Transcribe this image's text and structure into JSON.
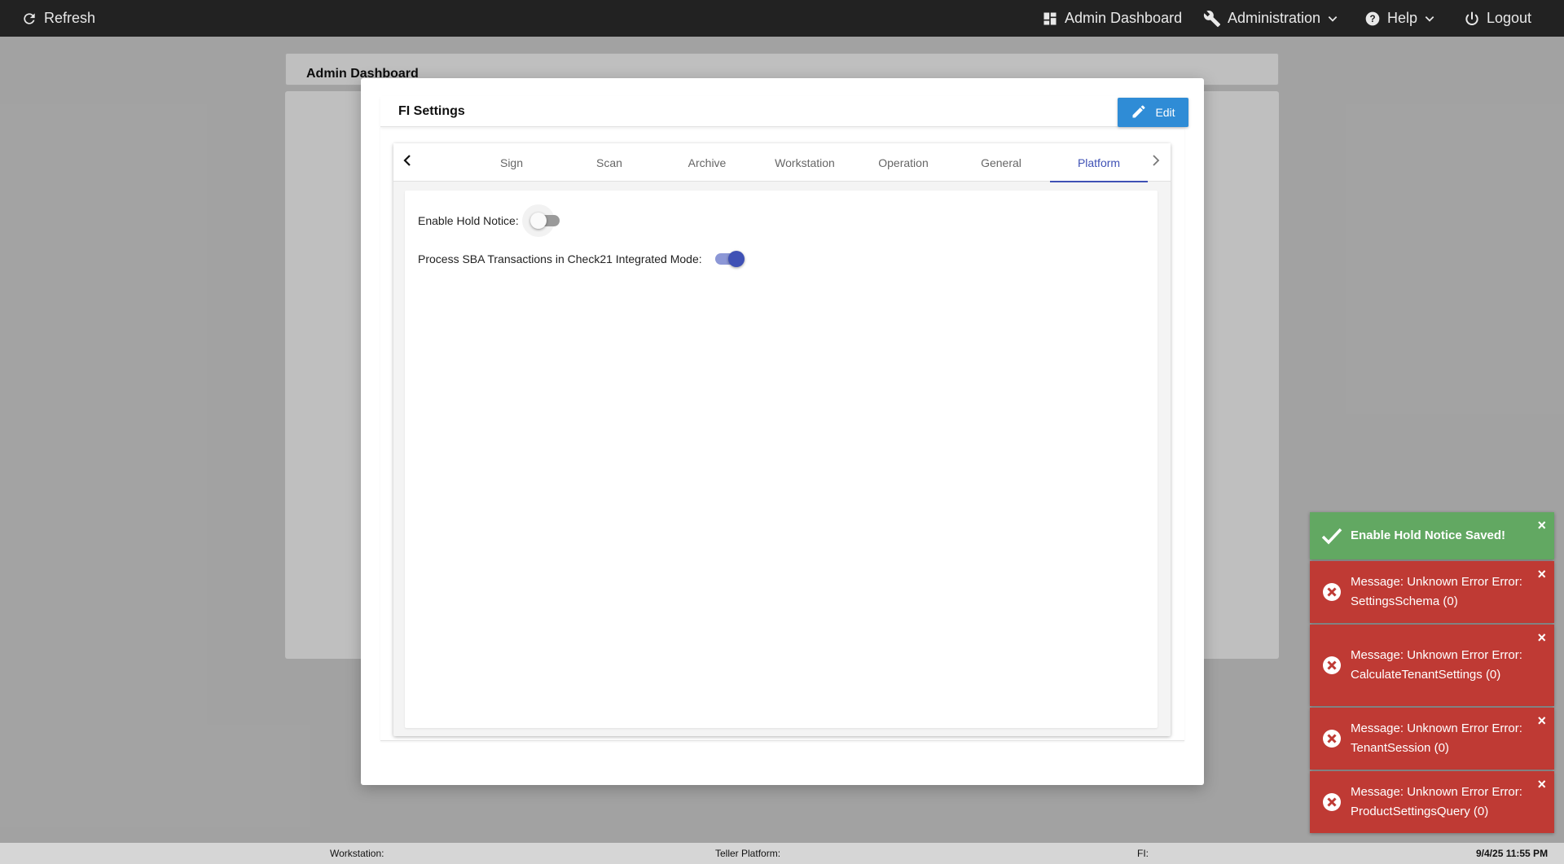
{
  "topbar": {
    "refresh_label": "Refresh",
    "dashboard_label": "Admin Dashboard",
    "administration_label": "Administration",
    "help_label": "Help",
    "logout_label": "Logout"
  },
  "page": {
    "header_title": "Admin Dashboard"
  },
  "modal": {
    "title": "FI Settings",
    "edit_label": "Edit",
    "tabs": [
      "Sign",
      "Scan",
      "Archive",
      "Workstation",
      "Operation",
      "General",
      "Platform"
    ],
    "active_tab": "Platform",
    "settings": [
      {
        "label": "Enable Hold Notice:",
        "enabled": false
      },
      {
        "label": "Process SBA Transactions in Check21 Integrated Mode:",
        "enabled": true
      }
    ]
  },
  "statusbar": {
    "workstation_label": "Workstation:",
    "teller_platform_label": "Teller Platform:",
    "fi_label": "FI:",
    "datetime": "9/4/25 11:55 PM"
  },
  "toasts": [
    {
      "type": "success",
      "text": "Enable Hold Notice Saved!",
      "close": "×"
    },
    {
      "type": "error",
      "text": "Message: Unknown Error Error: SettingsSchema (0)",
      "close": "×"
    },
    {
      "type": "error",
      "text": "Message: Unknown Error Error: CalculateTenantSettings (0)",
      "close": "×"
    },
    {
      "type": "error",
      "text": "Message: Unknown Error Error: TenantSession (0)",
      "close": "×"
    },
    {
      "type": "error",
      "text": "Message: Unknown Error Error: ProductSettingsQuery (0)",
      "close": "×"
    }
  ],
  "colors": {
    "topbar_bg": "#222222",
    "accent": "#3f51b5",
    "edit_button": "#2f8cd6",
    "success": "#62a862",
    "error": "#bf3a34"
  }
}
